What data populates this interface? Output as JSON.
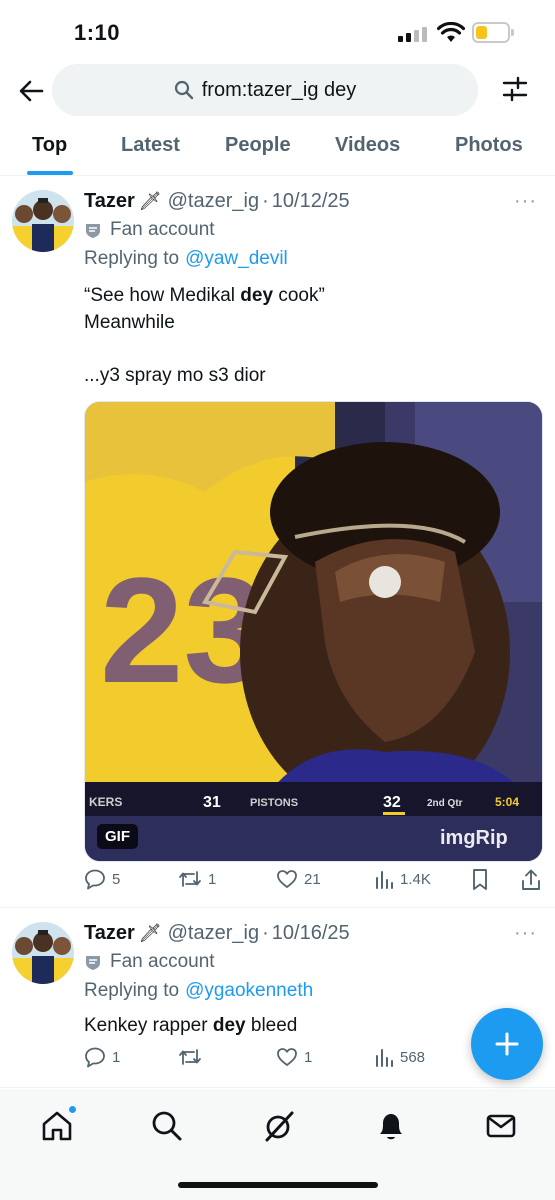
{
  "status_bar": {
    "time": "1:10",
    "battery_level": 0.35
  },
  "search": {
    "query": "from:tazer_ig dey"
  },
  "tabs": [
    {
      "label": "Top",
      "active": true
    },
    {
      "label": "Latest",
      "active": false
    },
    {
      "label": "People",
      "active": false
    },
    {
      "label": "Videos",
      "active": false
    },
    {
      "label": "Photos",
      "active": false
    }
  ],
  "tweets": [
    {
      "display_name": "Tazer",
      "name_emoji": "🗡",
      "handle": "@tazer_ig",
      "date": "10/12/25",
      "badge": "Fan account",
      "replying_label": "Replying to",
      "replying_to": "@yaw_devil",
      "text_line1_pre": "“See how Medikal ",
      "text_line1_bold": "dey",
      "text_line1_post": " cook”",
      "text_line2": "Meanwhile",
      "text_line3": "...y3 spray mo s3 dior",
      "media": {
        "badge": "GIF",
        "scoreboard_team1": "KERS",
        "scoreboard_score1": "31",
        "scoreboard_team2": "PISTONS",
        "scoreboard_score2": "32",
        "scoreboard_period": "2nd Qtr",
        "scoreboard_clock": "5:04",
        "watermark": "imgRip",
        "jersey_number": "23"
      },
      "stats": {
        "replies": "5",
        "reposts": "1",
        "likes": "21",
        "views": "1.4K"
      }
    },
    {
      "display_name": "Tazer",
      "name_emoji": "🗡",
      "handle": "@tazer_ig",
      "date": "10/16/25",
      "badge": "Fan account",
      "replying_label": "Replying to",
      "replying_to": "@ygaokenneth",
      "text_pre": "Kenkey rapper ",
      "text_bold": "dey",
      "text_post": " bleed",
      "stats": {
        "replies": "1",
        "reposts": "",
        "likes": "1",
        "views": "568"
      }
    }
  ],
  "colors": {
    "accent": "#1d9bf0",
    "text_primary": "#0f1419",
    "text_secondary": "#536471"
  },
  "bottom_nav": [
    "home-icon",
    "search-icon",
    "grok-icon",
    "notifications-icon",
    "messages-icon"
  ]
}
